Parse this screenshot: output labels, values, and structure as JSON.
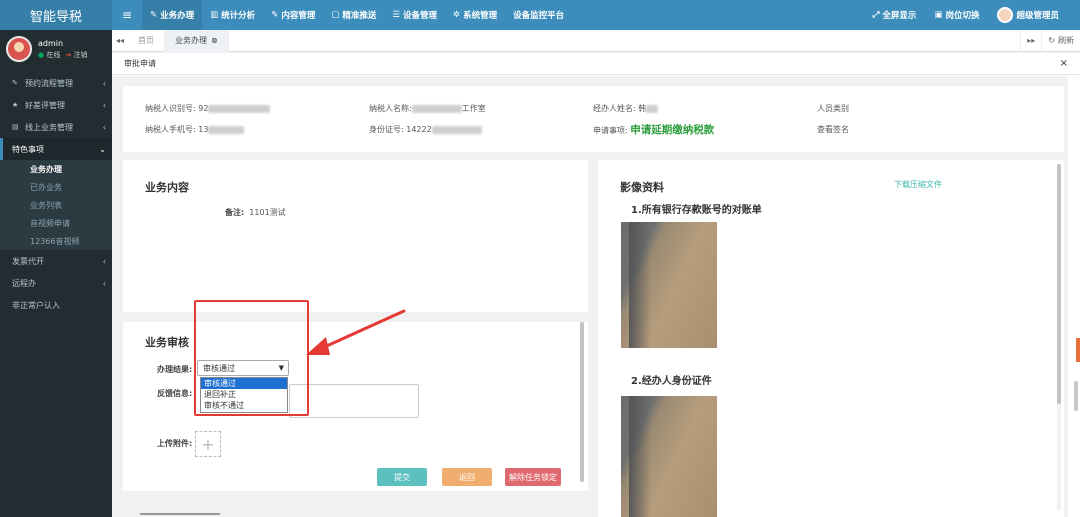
{
  "app": {
    "brand": "智能导税"
  },
  "topnav": [
    {
      "icon": "pen-icon",
      "glyph": "✎",
      "label": "业务办理",
      "active": true
    },
    {
      "icon": "bar-chart-icon",
      "glyph": "▥",
      "label": "统计分析",
      "active": false
    },
    {
      "icon": "edit-icon",
      "glyph": "✎",
      "label": "内容管理",
      "active": false
    },
    {
      "icon": "map-icon",
      "glyph": "▢",
      "label": "精准推送",
      "active": false
    },
    {
      "icon": "list-icon",
      "glyph": "☰",
      "label": "设备管理",
      "active": false
    },
    {
      "icon": "gear-icon",
      "glyph": "✲",
      "label": "系统管理",
      "active": false
    },
    {
      "icon": "",
      "glyph": "",
      "label": "设备监控平台",
      "active": false
    }
  ],
  "topright": {
    "fullscreen": "全屏显示",
    "switch_role": "岗位切换",
    "user": "超级管理员"
  },
  "user": {
    "name": "admin",
    "status_online": "在线",
    "status_logout": "注销"
  },
  "sidebar": {
    "items": [
      {
        "label": "预约流程管理",
        "glyph": "✎"
      },
      {
        "label": "好差评管理",
        "glyph": "★"
      },
      {
        "label": "线上业务管理",
        "glyph": "▤"
      }
    ],
    "open_item": "特色事项",
    "sub_items": [
      "业务办理",
      "已办业务",
      "业务列表",
      "音视频申请",
      "12366音视频"
    ],
    "active_sub": 0,
    "after_items": [
      "发票代开",
      "远程办",
      "非正常户认入"
    ]
  },
  "tabs": {
    "home": "首页",
    "current": "业务办理",
    "refresh": "刷新"
  },
  "dialog": {
    "title": "审批申请"
  },
  "info": {
    "taxpayer_id_label": "纳税人识别号:",
    "taxpayer_id_value": "92",
    "taxpayer_name_label": "纳税人名称:",
    "taxpayer_name_suffix": "工作室",
    "agent_name_label": "经办人姓名:",
    "agent_name_value": "韩",
    "person_type_label": "人员类别",
    "phone_label": "纳税人手机号:",
    "phone_value": "13",
    "idcard_label": "身份证号:",
    "idcard_value": "14222",
    "apply_item_label": "申请事项:",
    "apply_item_value": "申请延期缴纳税款",
    "sign_link": "查看签名"
  },
  "business": {
    "title": "业务内容",
    "remark_label": "备注:",
    "remark_value": "1101测试"
  },
  "images": {
    "title": "影像资料",
    "download": "下载压缩文件",
    "section1": "1.所有银行存款账号的对账单",
    "section2": "2.经办人身份证件"
  },
  "audit": {
    "title": "业务审核",
    "result_label": "办理结果:",
    "selected": "审核通过",
    "options": [
      "审核通过",
      "退回补正",
      "审核不通过"
    ],
    "feedback_label": "反馈信息:",
    "upload_label": "上传附件:",
    "submit": "提交",
    "back": "返回",
    "unlock": "解除任务锁定"
  },
  "colors": {
    "topbar": "#3c8dbc",
    "sidebar": "#222d32",
    "accent_green": "#2e9e3e",
    "submit_btn": "#5bc0be",
    "back_btn": "#f0ad6e",
    "unlock_btn": "#e0686f",
    "annotation": "#e53935"
  }
}
